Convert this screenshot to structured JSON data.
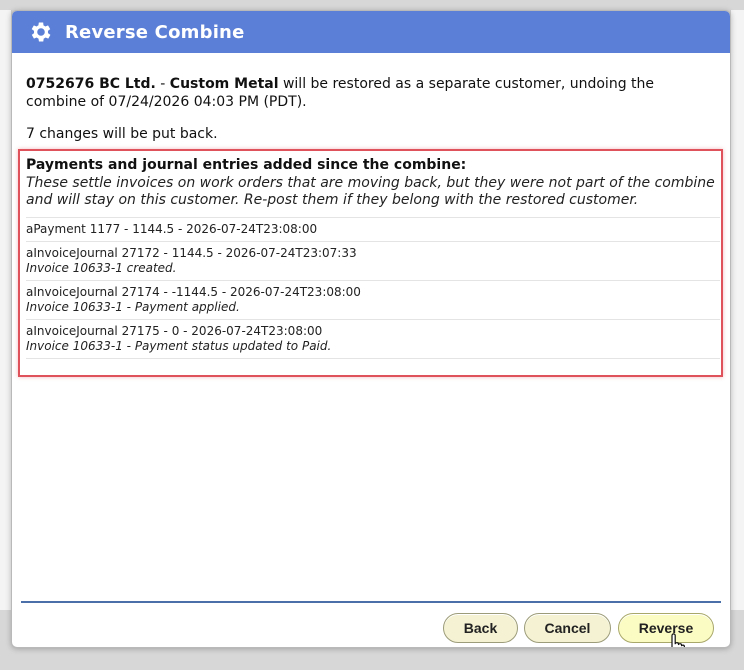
{
  "dialog": {
    "title": "Reverse Combine",
    "title_icon": "gear-icon",
    "header_color": "#5b7fd6"
  },
  "intro": {
    "customer_number": "0752676 BC Ltd.",
    "separator": " - ",
    "customer_name": "Custom Metal",
    "message": " will be restored as a separate customer, undoing the combine of 07/24/2026 04:03 PM (PDT)."
  },
  "changes_text": "7 changes will be put back.",
  "entries_section": {
    "heading": "Payments and journal entries added since the combine:",
    "note": "These settle invoices on work orders that are moving back, but they were not part of the combine and will stay on this customer. Re-post them if they belong with the restored customer.",
    "highlight_color": "#e0525b",
    "items": [
      {
        "line": "aPayment 1177 - 1144.5 - 2026-07-24T23:08:00",
        "desc": ""
      },
      {
        "line": "aInvoiceJournal 27172 - 1144.5 - 2026-07-24T23:07:33",
        "desc": "Invoice 10633-1 created."
      },
      {
        "line": "aInvoiceJournal 27174 - -1144.5 - 2026-07-24T23:08:00",
        "desc": "Invoice 10633-1 - Payment applied."
      },
      {
        "line": "aInvoiceJournal 27175 - 0 - 2026-07-24T23:08:00",
        "desc": "Invoice 10633-1 - Payment status updated to Paid."
      }
    ]
  },
  "buttons": {
    "back": "Back",
    "cancel": "Cancel",
    "reverse": "Reverse"
  },
  "cursor": "hand-pointer-icon"
}
